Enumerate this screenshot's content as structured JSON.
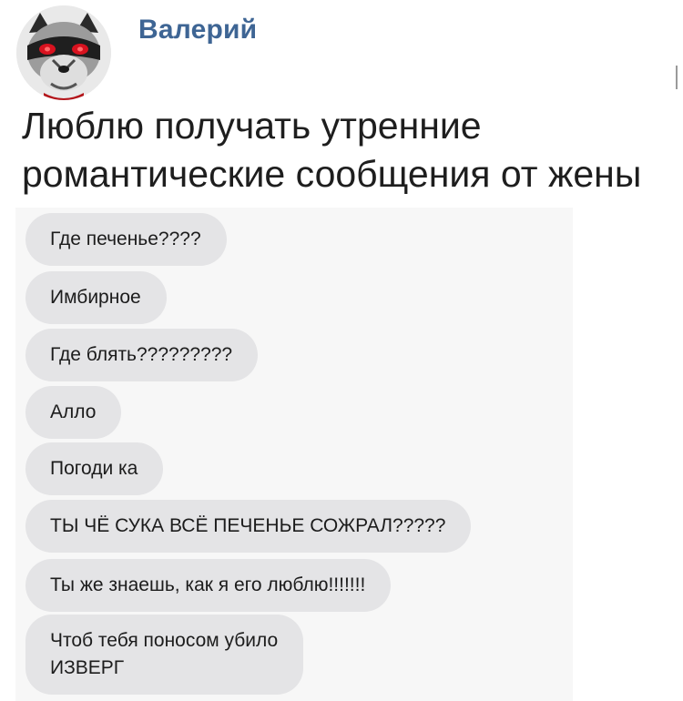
{
  "post": {
    "author": "Валерий",
    "avatar_icon": "raccoon-avatar-icon",
    "text_line1": "Люблю получать утренние",
    "text_line2": "романтические сообщения от жены"
  },
  "colors": {
    "author_name": "#3e6594",
    "bubble_bg": "#e4e4e6",
    "chat_bg": "#f7f7f7",
    "text": "#1e1e1e"
  },
  "messages": [
    {
      "text": "Где печенье????"
    },
    {
      "text": "Имбирное"
    },
    {
      "text": "Где блять?????????"
    },
    {
      "text": "Алло"
    },
    {
      "text": "Погоди ка"
    },
    {
      "text": "ТЫ ЧЁ СУКА ВСЁ ПЕЧЕНЬЕ СОЖРАЛ?????"
    },
    {
      "text": "Ты же знаешь, как я его люблю!!!!!!!"
    },
    {
      "text_line1": "Чтоб тебя поносом убило",
      "text_line2": "ИЗВЕРГ"
    }
  ]
}
